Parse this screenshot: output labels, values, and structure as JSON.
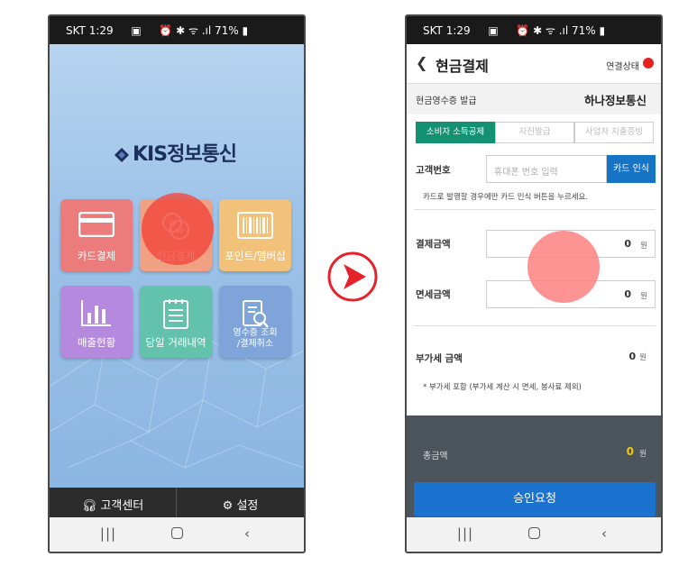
{
  "phone1": {
    "status": {
      "carrier_time": "SKT 1:29",
      "icons": "⏰ ✱ ᯤ .ıl",
      "battery": "71%"
    },
    "brand": "KIS정보통신",
    "tiles": [
      {
        "label": "카드결제",
        "icon": "card-icon"
      },
      {
        "label": "현금결제",
        "icon": "coins-icon"
      },
      {
        "label": "포인트/멤버십",
        "icon": "barcode-icon"
      },
      {
        "label": "매출현황",
        "icon": "bar-chart-icon"
      },
      {
        "label": "당일 거래내역",
        "icon": "notepad-icon"
      },
      {
        "label_line1": "영수증 조회",
        "label_line2": "/결제취소",
        "icon": "receipt-search-icon"
      }
    ],
    "bottom": {
      "support": "고객센터",
      "settings": "설정"
    }
  },
  "phone2": {
    "status": {
      "carrier_time": "SKT 1:29",
      "icons": "⏰ ✱ ᯤ .ıl",
      "battery": "71%"
    },
    "title": "현금결제",
    "connection_label": "연결상태",
    "connection_color": "#e52222",
    "receipt_issue_label": "현금영수증 발급",
    "merchant_name": "하나정보통신",
    "tabs": [
      "소비자 소득공제",
      "자진발급",
      "사업자 지출증빙"
    ],
    "active_tab": 0,
    "customer_label": "고객번호",
    "phone_placeholder": "휴대폰 번호 입력",
    "card_button": "카드 인식",
    "card_hint": "카드로 발행할 경우에만 카드 인식 버튼을 누르세요.",
    "payment_label": "결제금액",
    "payment_amount": "0",
    "taxfree_label": "면세금액",
    "taxfree_amount": "0",
    "currency_unit": "원",
    "vat_label": "부가세 금액",
    "vat_amount": "0",
    "vat_note": "* 부가세 포함 (부가세 계산 시 면세, 봉사료 제외)",
    "total_label": "총금액",
    "total_amount": "0",
    "approve_button": "승인요청"
  },
  "colors": {
    "accent_green": "#149073",
    "primary_blue": "#1b72cf",
    "total_yellow": "#f2c60f",
    "arrow_red": "#e8222a"
  }
}
